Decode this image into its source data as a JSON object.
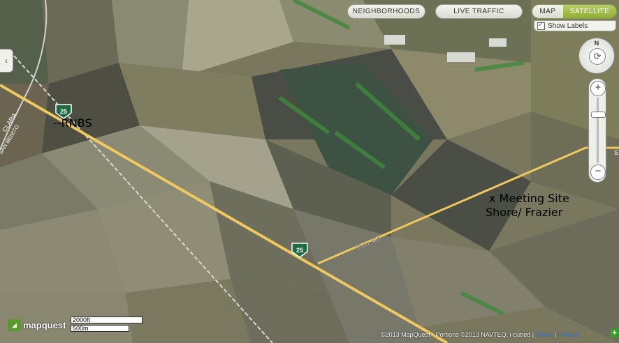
{
  "controls": {
    "neighborhoods": "NEIGHBORHOODS",
    "live_traffic": "LIVE TRAFFIC",
    "map": "MAP",
    "satellite": "SATELLITE",
    "show_labels": "Show Labels",
    "compass_north": "N",
    "zoom_in": "+",
    "zoom_out": "−",
    "collapse": "‹"
  },
  "map": {
    "route_shield": "25",
    "road_label": "Shore Rd",
    "place_label_1": "CLARA",
    "place_label_2": "SAN BENITO",
    "partial_right_label": "S",
    "annotation_rnbs": "--RNBS",
    "annotation_meeting_1": "x Meeting Site",
    "annotation_meeting_2": "Shore/ Frazier",
    "road_color": "#f0c860",
    "rail_color": "#d9d9d0"
  },
  "footer": {
    "logo": "mapquest",
    "scale_ft": "2000ft",
    "scale_m": "500m",
    "copyright": "©2013 MapQuest - Portions ©2013 NAVTEQ, i-cubed |",
    "terms": "Terms",
    "privacy": "Privacy",
    "expand": "+"
  }
}
